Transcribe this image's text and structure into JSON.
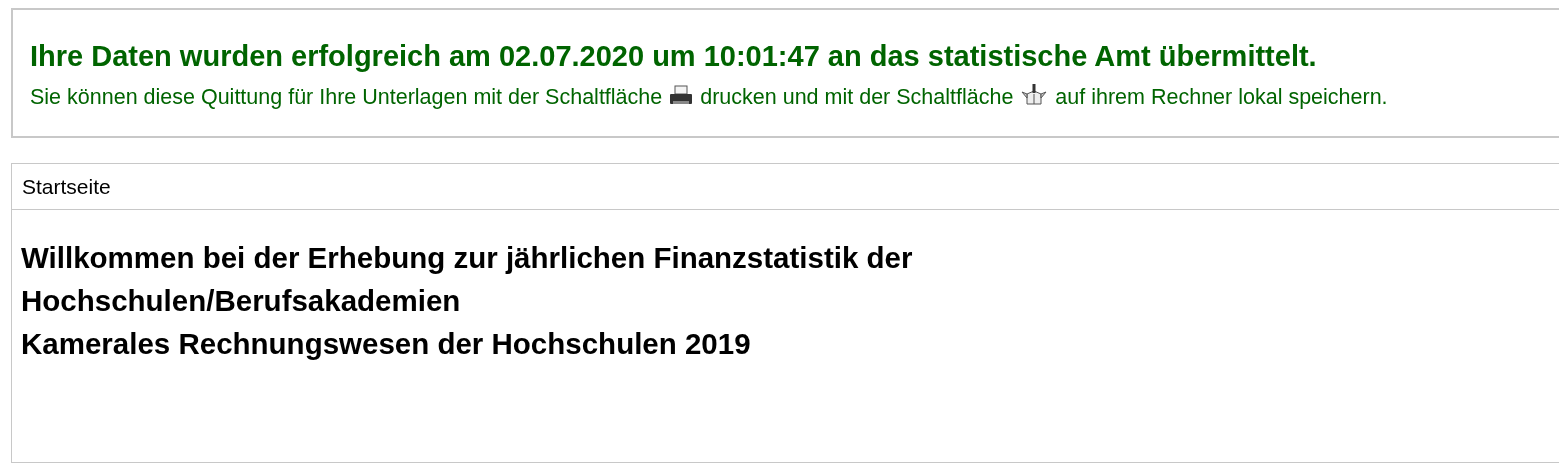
{
  "notice": {
    "heading": "Ihre Daten wurden erfolgreich am 02.07.2020 um 10:01:47 an das statistische Amt übermittelt.",
    "text_parts": [
      "Sie können diese Quittung für Ihre Unterlagen mit der Schaltfläche",
      "drucken und mit der Schaltfläche",
      "auf ihrem Rechner lokal speichern."
    ]
  },
  "panel": {
    "breadcrumb": "Startseite",
    "title_lines": [
      "Willkommen bei der Erhebung zur jährlichen Finanzstatistik der",
      "Hochschulen/Berufsakademien",
      "Kamerales Rechnungswesen der Hochschulen 2019"
    ]
  }
}
